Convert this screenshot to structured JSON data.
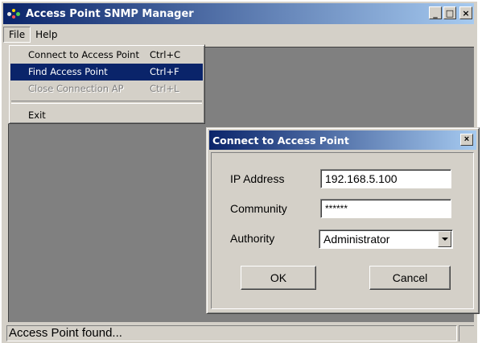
{
  "window": {
    "title": "Access Point SNMP Manager",
    "minimize_glyph": "_",
    "maximize_glyph": "□",
    "close_glyph": "×"
  },
  "menubar": {
    "items": [
      "File",
      "Help"
    ]
  },
  "file_menu": {
    "items": [
      {
        "label": "Connect to Access Point",
        "shortcut": "Ctrl+C",
        "state": "normal"
      },
      {
        "label": "Find Access Point",
        "shortcut": "Ctrl+F",
        "state": "highlighted"
      },
      {
        "label": "Close Connection AP",
        "shortcut": "Ctrl+L",
        "state": "disabled"
      },
      {
        "label": "Exit",
        "shortcut": "",
        "state": "normal"
      }
    ]
  },
  "dialog": {
    "title": "Connect to Access Point",
    "close_glyph": "×",
    "ip_label": "IP Address",
    "ip_value": "192.168.5.100",
    "community_label": "Community",
    "community_value": "******",
    "authority_label": "Authority",
    "authority_value": "Administrator",
    "ok_label": "OK",
    "cancel_label": "Cancel"
  },
  "status": {
    "text": "Access Point found..."
  },
  "colors": {
    "titlebar_start": "#0a246a",
    "titlebar_end": "#a6caf0",
    "face": "#d4d0c8",
    "mdi_background": "#808080",
    "highlight": "#0a246a"
  }
}
